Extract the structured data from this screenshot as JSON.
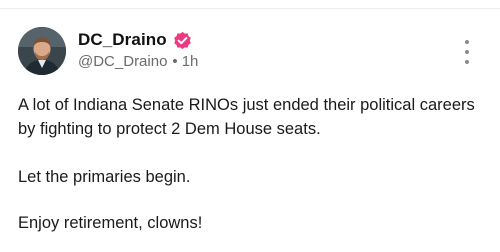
{
  "post": {
    "display_name": "DC_Draino",
    "handle": "@DC_Draino",
    "separator": "•",
    "time_ago": "1h",
    "verified_color": "#ec3b83",
    "paragraphs": [
      "A lot of Indiana Senate RINOs just ended their political careers by fighting to protect 2 Dem House seats.",
      "Let the primaries begin.",
      "Enjoy retirement, clowns!"
    ]
  },
  "icons": {
    "verified": "verified-badge-icon",
    "more": "more-options-icon"
  }
}
